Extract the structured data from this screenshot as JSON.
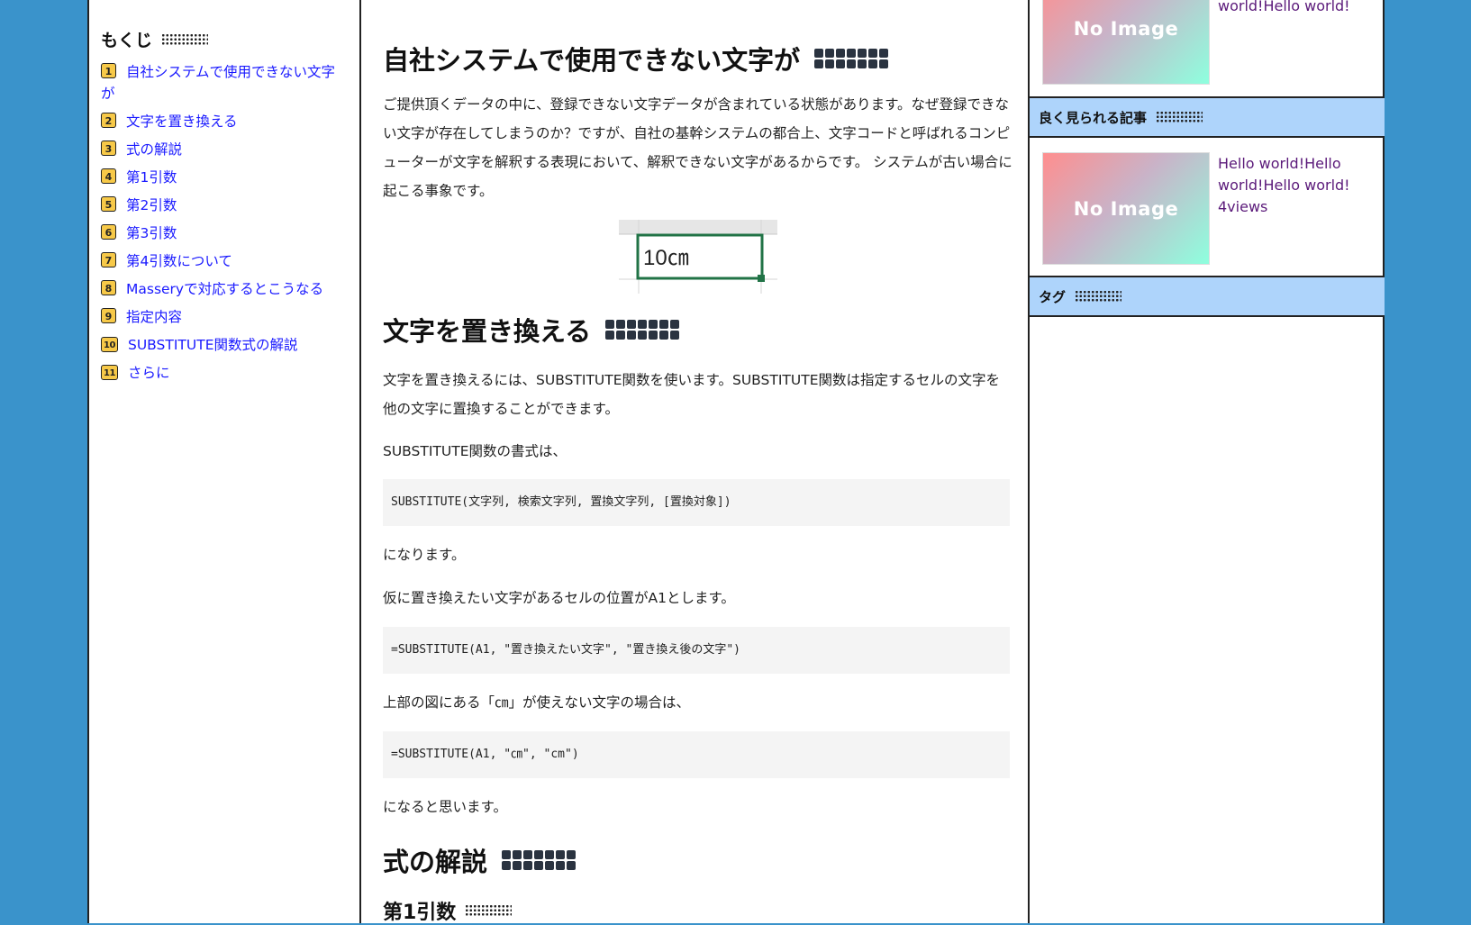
{
  "toc": {
    "title": "もくじ",
    "items": [
      {
        "num": "1",
        "label": "自社システムで使用できない文字が"
      },
      {
        "num": "2",
        "label": "文字を置き換える"
      },
      {
        "num": "3",
        "label": "式の解説"
      },
      {
        "num": "4",
        "label": "第1引数"
      },
      {
        "num": "5",
        "label": "第2引数"
      },
      {
        "num": "6",
        "label": "第3引数"
      },
      {
        "num": "7",
        "label": "第4引数について"
      },
      {
        "num": "8",
        "label": "Masseryで対応するとこうなる"
      },
      {
        "num": "9",
        "label": "指定内容"
      },
      {
        "num": "10",
        "label": "SUBSTITUTE関数式の解説"
      },
      {
        "num": "11",
        "label": "さらに"
      }
    ]
  },
  "article": {
    "h2_1": "自社システムで使用できない文字が",
    "p1": "ご提供頂くデータの中に、登録できない文字データが含まれている状態があります。なぜ登録できない文字が存在してしまうのか？ですが、自社の基幹システムの都合上、文字コードと呼ばれるコンピューターが文字を解釈する表現において、解釈できない文字があるからです。 システムが古い場合に起こる事象です。",
    "cell_text": "10㎝",
    "h2_2": "文字を置き換える",
    "p2": "文字を置き換えるには、SUBSTITUTE関数を使います。SUBSTITUTE関数は指定するセルの文字を他の文字に置換することができます。",
    "p3": "SUBSTITUTE関数の書式は、",
    "code1": "SUBSTITUTE(文字列, 検索文字列, 置換文字列, [置換対象])",
    "p4": "になります。",
    "p5": "仮に置き換えたい文字があるセルの位置がA1とします。",
    "code2": "=SUBSTITUTE(A1, \"置き換えたい文字\", \"置き換え後の文字\")",
    "p6": "上部の図にある「㎝」が使えない文字の場合は、",
    "code3": "=SUBSTITUTE(A1, \"㎝\", \"cm\")",
    "p7": "になると思います。",
    "h2_3": "式の解説",
    "h3_1": "第1引数"
  },
  "sidebar": {
    "top_post": {
      "thumb": "No Image",
      "title_tail": "world!Hello world!"
    },
    "popular_title": "良く見られる記事",
    "popular_post": {
      "thumb": "No Image",
      "title": "Hello world!Hello world!Hello world!",
      "views": "4views"
    },
    "tags_title": "タグ"
  }
}
